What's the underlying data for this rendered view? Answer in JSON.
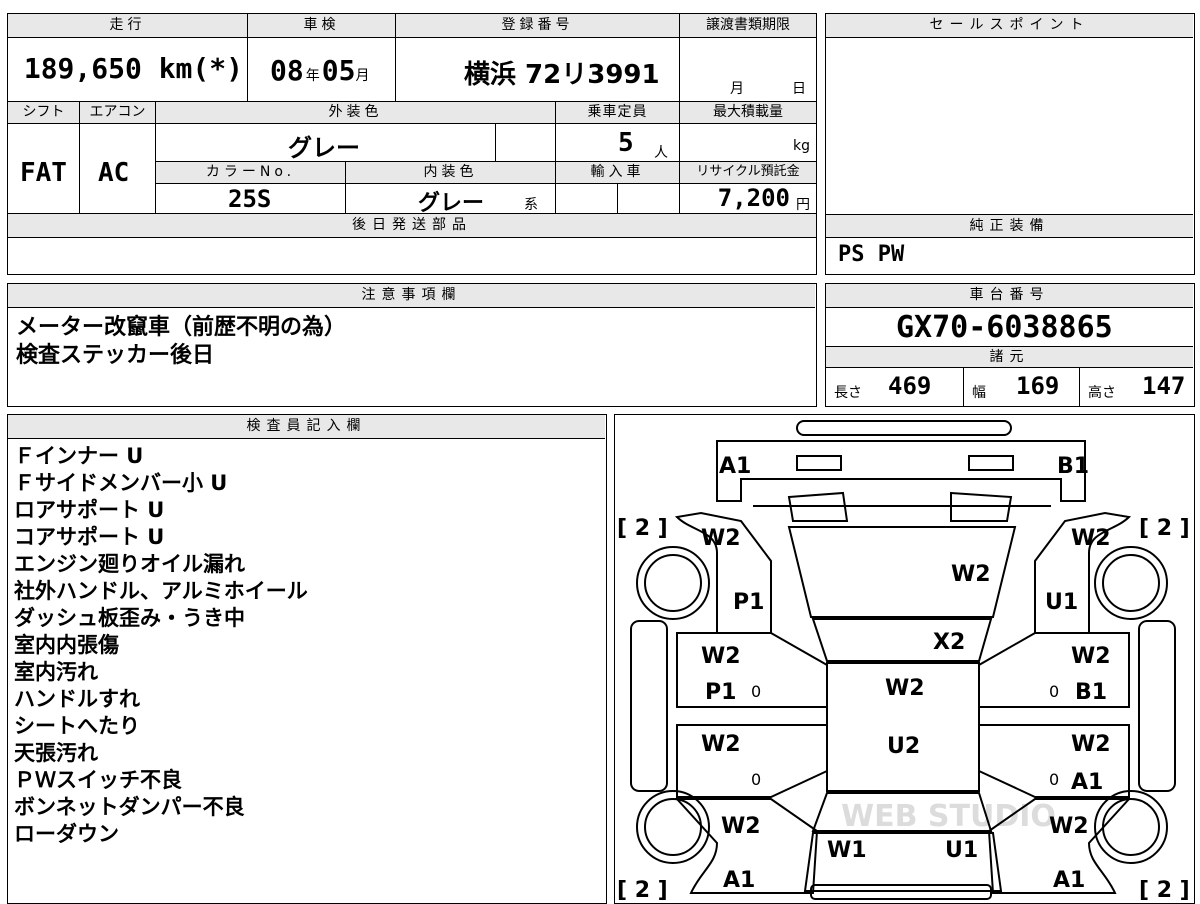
{
  "top_row": {
    "mileage_label": "走行",
    "mileage": "189,650 km(*)",
    "inspection_label": "車検",
    "inspection_year": "08",
    "inspection_year_unit": "年",
    "inspection_month": "05",
    "inspection_month_unit": "月",
    "plate_label": "登録番号",
    "plate": "横浜 72リ3991",
    "transfer_label": "譲渡書類期限",
    "transfer_month_unit": "月",
    "transfer_day_unit": "日"
  },
  "second_row": {
    "shift_label": "シフト",
    "shift": "FAT",
    "ac_label": "エアコン",
    "ac": "AC",
    "exterior_label": "外装色",
    "exterior_color": "グレー",
    "capacity_label": "乗車定員",
    "capacity": "5",
    "capacity_unit": "人",
    "max_load_label": "最大積載量",
    "max_load_unit": "kg",
    "color_no_label": "カラーNo.",
    "color_no": "25S",
    "interior_label": "内装色",
    "interior_color": "グレー",
    "interior_suffix": "系",
    "import_label": "輸入車",
    "recycle_label": "リサイクル預託金",
    "recycle_fee": "7,200",
    "recycle_unit": "円"
  },
  "later_parts": {
    "label": "後日発送部品",
    "value": ""
  },
  "sales_point": {
    "label": "セールスポイント"
  },
  "genuine_equipment": {
    "label": "純正装備",
    "value": "PS PW"
  },
  "notes": {
    "label": "注意事項欄",
    "lines": [
      "メーター改竄車（前歴不明の為）",
      "検査ステッカー後日"
    ]
  },
  "chassis": {
    "label": "車台番号",
    "value": "GX70-6038865",
    "specs_label": "諸元",
    "length_label": "長さ",
    "length": "469",
    "width_label": "幅",
    "width": "169",
    "height_label": "高さ",
    "height": "147"
  },
  "inspector": {
    "label": "検査員記入欄",
    "lines": [
      "Ｆインナー U",
      "Ｆサイドメンバー小 U",
      "ロアサポート U",
      "コアサポート U",
      "エンジン廻りオイル漏れ",
      "社外ハンドル、アルミホイール",
      "ダッシュ板歪み・うき中",
      "室内内張傷",
      "室内汚れ",
      "ハンドルすれ",
      "シートへたり",
      "天張汚れ",
      "ＰＷスイッチ不良",
      "ボンネットダンパー不良",
      "ローダウン"
    ]
  },
  "diagram": {
    "watermark": "WEB STUDIO",
    "tire_marks": [
      "[ 2 ]",
      "[ 2 ]",
      "[ 2 ]",
      "[ 2 ]"
    ],
    "marks": [
      "A1",
      "B1",
      "W2",
      "W2",
      "W2",
      "P1",
      "U1",
      "X2",
      "W2",
      "W2",
      "W2",
      "P1",
      "B1",
      "W2",
      "W2",
      "U2",
      "W2",
      "A1",
      "W2",
      "W2",
      "W1",
      "U1",
      "A1",
      "A1"
    ],
    "zeros": [
      "0",
      "0",
      "0",
      "0"
    ]
  }
}
